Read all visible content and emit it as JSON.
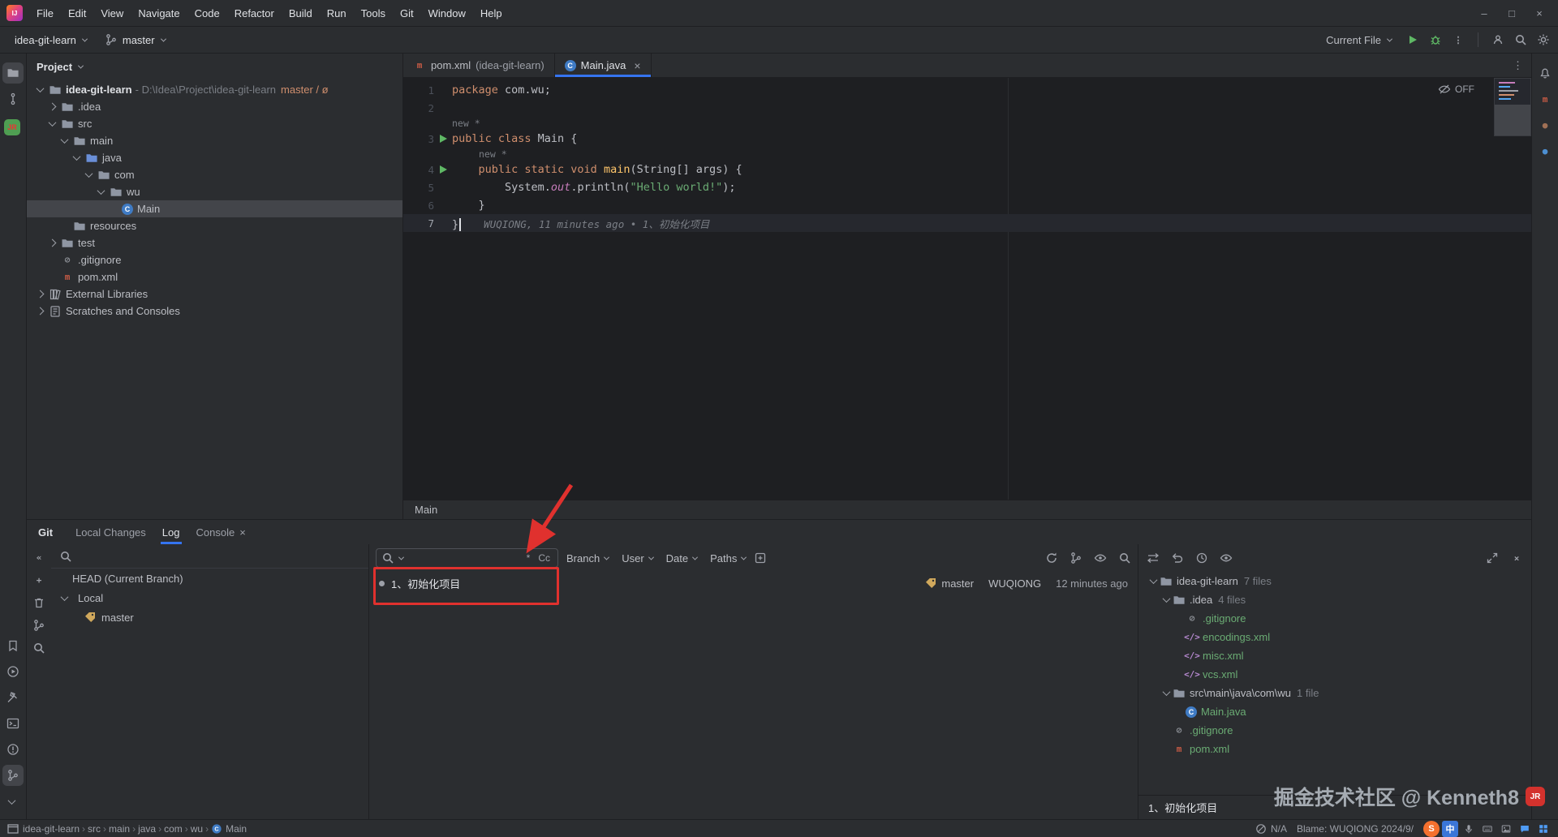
{
  "colors": {
    "accent": "#3574f0",
    "annotation_red": "#e0312e",
    "added_file_green": "#6aab73",
    "keyword_orange": "#cf8e6d",
    "string_green": "#6aab73",
    "branch_tag_yellow": "#d0a85c"
  },
  "menu_bar": {
    "items": [
      "File",
      "Edit",
      "View",
      "Navigate",
      "Code",
      "Refactor",
      "Build",
      "Run",
      "Tools",
      "Git",
      "Window",
      "Help"
    ],
    "window_controls": [
      "minimize-icon",
      "maximize-icon",
      "close-icon"
    ]
  },
  "toolbar": {
    "project": "idea-git-learn",
    "branch": "master",
    "run_config": "Current File",
    "right_icons": [
      "run-icon",
      "debug-icon",
      "more-vertical-icon",
      "collaborate-icon",
      "search-icon",
      "settings-icon"
    ]
  },
  "left_strip": {
    "top": [
      "project-folder-icon",
      "commit-graph-icon",
      "more-horizontal-icon"
    ],
    "bottom": [
      "bookmarks-icon",
      "services-icon",
      "build-icon",
      "terminal-icon",
      "problems-icon",
      "git-icon",
      "chevron-more-icon"
    ],
    "active_top": "project-folder-icon",
    "active_bottom": "git-icon"
  },
  "right_strip": [
    "notifications-icon",
    "maven-icon",
    "database-icon",
    "gradle-icon"
  ],
  "project_panel": {
    "title": "Project",
    "tree": [
      {
        "depth": 0,
        "chevron": "down",
        "icon": "folder",
        "label": "idea-git-learn",
        "path": " - D:\\Idea\\Project\\idea-git-learn",
        "badge": "master / ø",
        "bold": true
      },
      {
        "depth": 1,
        "chevron": "right",
        "icon": "folder",
        "label": ".idea"
      },
      {
        "depth": 1,
        "chevron": "down",
        "icon": "folder",
        "label": "src"
      },
      {
        "depth": 2,
        "chevron": "down",
        "icon": "folder",
        "label": "main"
      },
      {
        "depth": 3,
        "chevron": "down",
        "icon": "folder-java",
        "label": "java"
      },
      {
        "depth": 4,
        "chevron": "down",
        "icon": "package",
        "label": "com"
      },
      {
        "depth": 5,
        "chevron": "down",
        "icon": "package",
        "label": "wu"
      },
      {
        "depth": 6,
        "chevron": "",
        "icon": "class",
        "label": "Main",
        "selected": true
      },
      {
        "depth": 2,
        "chevron": "",
        "icon": "folder",
        "label": "resources"
      },
      {
        "depth": 1,
        "chevron": "right",
        "icon": "folder",
        "label": "test"
      },
      {
        "depth": 1,
        "chevron": "",
        "icon": "gitignore",
        "label": ".gitignore"
      },
      {
        "depth": 1,
        "chevron": "",
        "icon": "maven",
        "label": "pom.xml"
      },
      {
        "depth": 0,
        "chevron": "right",
        "icon": "library",
        "label": "External Libraries"
      },
      {
        "depth": 0,
        "chevron": "right",
        "icon": "scratches",
        "label": "Scratches and Consoles"
      }
    ]
  },
  "editor": {
    "tabs": [
      {
        "label": "pom.xml",
        "hint": "(idea-git-learn)",
        "icon": "maven",
        "active": false,
        "close": false
      },
      {
        "label": "Main.java",
        "hint": "",
        "icon": "class",
        "active": true,
        "close": true
      }
    ],
    "reader_mode": "OFF",
    "breadcrumb": "Main",
    "code": {
      "lines": [
        {
          "num": "1",
          "tokens": [
            {
              "t": "package ",
              "c": "kw"
            },
            {
              "t": "com.wu;",
              "c": "pl"
            }
          ]
        },
        {
          "num": "2",
          "tokens": []
        },
        {
          "inlay": "new *",
          "indent": 0
        },
        {
          "num": "3",
          "run": true,
          "tokens": [
            {
              "t": "public class ",
              "c": "kw"
            },
            {
              "t": "Main {",
              "c": "pl"
            }
          ]
        },
        {
          "inlay": "new *",
          "indent": 1
        },
        {
          "num": "4",
          "run": true,
          "tokens": [
            {
              "t": "    ",
              "c": "pl"
            },
            {
              "t": "public static void ",
              "c": "kw"
            },
            {
              "t": "main",
              "c": "mth"
            },
            {
              "t": "(String[] ",
              "c": "pl"
            },
            {
              "t": "args",
              "c": "pl"
            },
            {
              "t": ") {",
              "c": "pl"
            }
          ]
        },
        {
          "num": "5",
          "tokens": [
            {
              "t": "        System.",
              "c": "pl"
            },
            {
              "t": "out",
              "c": "fld"
            },
            {
              "t": ".",
              "c": "pl"
            },
            {
              "t": "println",
              "c": "pl"
            },
            {
              "t": "(",
              "c": "pl"
            },
            {
              "t": "\"Hello world!\"",
              "c": "str"
            },
            {
              "t": ");",
              "c": "pl"
            }
          ]
        },
        {
          "num": "6",
          "tokens": [
            {
              "t": "    }",
              "c": "pl"
            }
          ]
        },
        {
          "num": "7",
          "current": true,
          "cursor": true,
          "tokens": [
            {
              "t": "}",
              "c": "pl"
            }
          ],
          "blame": "WUQIONG, 11 minutes ago • 1、初始化项目"
        }
      ]
    }
  },
  "git_panel": {
    "title": "Git",
    "tabs": [
      {
        "label": "Local Changes",
        "active": false,
        "close": false
      },
      {
        "label": "Log",
        "active": true,
        "close": false
      },
      {
        "label": "Console",
        "active": false,
        "close": true
      }
    ],
    "branches_toolbar": [
      "collapse-icon",
      "add-icon",
      "delete-icon",
      "branch-icon",
      "search-icon"
    ],
    "branches": {
      "head": "HEAD (Current Branch)",
      "group": "Local",
      "item": "master"
    },
    "filter": {
      "regex": "*",
      "case": "Cc",
      "dropdowns": [
        "Branch",
        "User",
        "Date",
        "Paths"
      ],
      "extra_icon": "open-new-tab-icon",
      "right_icons": [
        "refresh-icon",
        "compare-branches-icon",
        "eye-icon",
        "find-icon"
      ]
    },
    "commits": [
      {
        "message": "1、初始化项目",
        "branch_tag": "master",
        "author": "WUQIONG",
        "time": "12 minutes ago"
      }
    ],
    "files_toolbar": {
      "left": [
        "compare-icon",
        "rollback-icon",
        "history-icon",
        "preview-icon"
      ],
      "right": [
        "expand-icon",
        "close-icon"
      ]
    },
    "files": [
      {
        "depth": 0,
        "chevron": "down",
        "icon": "folder",
        "label": "idea-git-learn",
        "count": "7 files",
        "color": "dir"
      },
      {
        "depth": 1,
        "chevron": "down",
        "icon": "folder",
        "label": ".idea",
        "count": "4 files",
        "color": "dir"
      },
      {
        "depth": 2,
        "chevron": "",
        "icon": "gitignore",
        "label": ".gitignore",
        "count": "",
        "color": "added"
      },
      {
        "depth": 2,
        "chevron": "",
        "icon": "xml",
        "label": "encodings.xml",
        "count": "",
        "color": "added"
      },
      {
        "depth": 2,
        "chevron": "",
        "icon": "xml",
        "label": "misc.xml",
        "count": "",
        "color": "added"
      },
      {
        "depth": 2,
        "chevron": "",
        "icon": "xml",
        "label": "vcs.xml",
        "count": "",
        "color": "added"
      },
      {
        "depth": 1,
        "chevron": "down",
        "icon": "folder",
        "label": "src\\main\\java\\com\\wu",
        "count": "1 file",
        "color": "dir"
      },
      {
        "depth": 2,
        "chevron": "",
        "icon": "class",
        "label": "Main.java",
        "count": "",
        "color": "added"
      },
      {
        "depth": 1,
        "chevron": "",
        "icon": "gitignore",
        "label": ".gitignore",
        "count": "",
        "color": "added"
      },
      {
        "depth": 1,
        "chevron": "",
        "icon": "maven",
        "label": "pom.xml",
        "count": "",
        "color": "added"
      }
    ],
    "commit_detail": "1、初始化项目"
  },
  "status_bar": {
    "breadcrumbs": [
      "idea-git-learn",
      "src",
      "main",
      "java",
      "com",
      "wu",
      "Main"
    ],
    "na": "N/A",
    "blame": "Blame: WUQIONG 2024/9/",
    "taskbar_icons": [
      "sogou-icon",
      "chinese-input-icon",
      "mic-icon",
      "keyboard-icon",
      "image-icon",
      "chat-icon",
      "start-grid-icon"
    ]
  },
  "watermark": {
    "text": "掘金技术社区 @ Kenneth8",
    "badge": "JR",
    "left_badge": "JR"
  }
}
